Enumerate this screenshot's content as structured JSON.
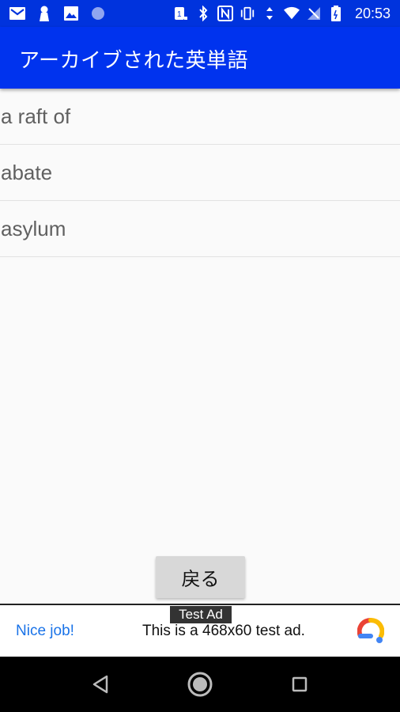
{
  "status_bar": {
    "time": "20:53",
    "icons_left": [
      "gmail-icon",
      "keyhole-icon",
      "image-icon",
      "circle-icon"
    ],
    "icons_right": [
      "sim-1-icon",
      "bluetooth-icon",
      "nfc-icon",
      "vibrate-icon",
      "data-arrows-icon",
      "wifi-icon",
      "no-signal-icon",
      "battery-icon"
    ]
  },
  "app_bar": {
    "title": "アーカイブされた英単語",
    "color": "#0033ee"
  },
  "word_list": {
    "items": [
      {
        "label": "a raft of"
      },
      {
        "label": "abate"
      },
      {
        "label": "asylum"
      }
    ]
  },
  "back_button": {
    "label": "戻る"
  },
  "ad": {
    "label": "Test Ad",
    "headline": "Nice job!",
    "body": "This is a 468x60 test ad.",
    "logo_icon": "admob-logo-icon"
  },
  "nav_bar": {
    "buttons": [
      "back-triangle-icon",
      "home-circle-icon",
      "recents-square-icon"
    ]
  }
}
